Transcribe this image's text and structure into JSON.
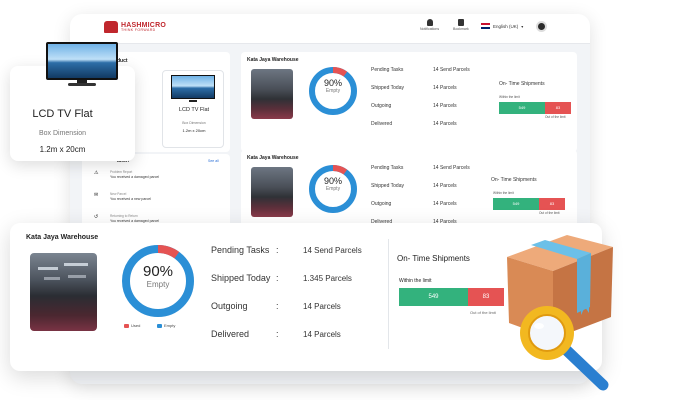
{
  "header": {
    "brand_name": "HASHMICRO",
    "brand_tagline": "THINK FORWARD",
    "notifications_label": "Notifications",
    "bookmark_label": "Bookmark",
    "language": "English (UK)"
  },
  "lcd_card": {
    "title": "LCD TV Flat",
    "subtitle": "Box Dimension",
    "size": "1.2m x 20cm"
  },
  "product_panel": {
    "heading": "roduct",
    "title": "LCD TV Flat",
    "subtitle": "Box Dimension",
    "size": "1.2m x 20cm"
  },
  "activity_panel": {
    "heading": "ation",
    "see_all": "See all",
    "items": [
      {
        "title": "Problem Report",
        "text": "You received a damaged parcel"
      },
      {
        "title": "New Parcel",
        "text": "You received a new parcel"
      },
      {
        "title": "Returning to Return",
        "text": "You received a damaged parcel"
      }
    ]
  },
  "warehouse": {
    "name": "Kata Jaya Warehouse",
    "percent_label": "90%",
    "percent_value": 90,
    "empty_label": "Empty",
    "legend": [
      {
        "label": "Used",
        "color": "#e55353"
      },
      {
        "label": "Empty",
        "color": "#2b8fd6"
      }
    ],
    "stats": [
      {
        "label": "Pending Tasks",
        "value": "14 Send Parcels"
      },
      {
        "label": "Shipped Today",
        "value": "1.345 Parcels"
      },
      {
        "label": "Outgoing",
        "value": "14 Parcels"
      },
      {
        "label": "Delivered",
        "value": "14 Parcels"
      }
    ],
    "ontime": {
      "title": "On- Time Shipments",
      "within_label": "Within the limit",
      "within_value": "549",
      "out_value": "83",
      "out_label": "Out of the limit"
    }
  },
  "mini_warehouses": [
    {
      "name": "Kata Jaya Warehouse",
      "percent_label": "90%",
      "empty_label": "Empty",
      "shipped_value": "14 Parcels",
      "ontime_title": "On- Time Shipments",
      "within_value": "549",
      "out_value": "83"
    },
    {
      "name": "Kata Jaya Warehouse",
      "percent_label": "90%",
      "empty_label": "Empty",
      "shipped_value": "14 Parcels",
      "ontime_title": "On- Time Shipments",
      "within_value": "549",
      "out_value": "83"
    }
  ],
  "colors": {
    "brand": "#c0272d",
    "donut_empty": "#2b8fd6",
    "donut_used": "#e55353",
    "bar_within": "#33b27d",
    "bar_out": "#e55353",
    "box": "#d98a55",
    "tape": "#6cc0e8",
    "magnifier": "#f2b820"
  }
}
